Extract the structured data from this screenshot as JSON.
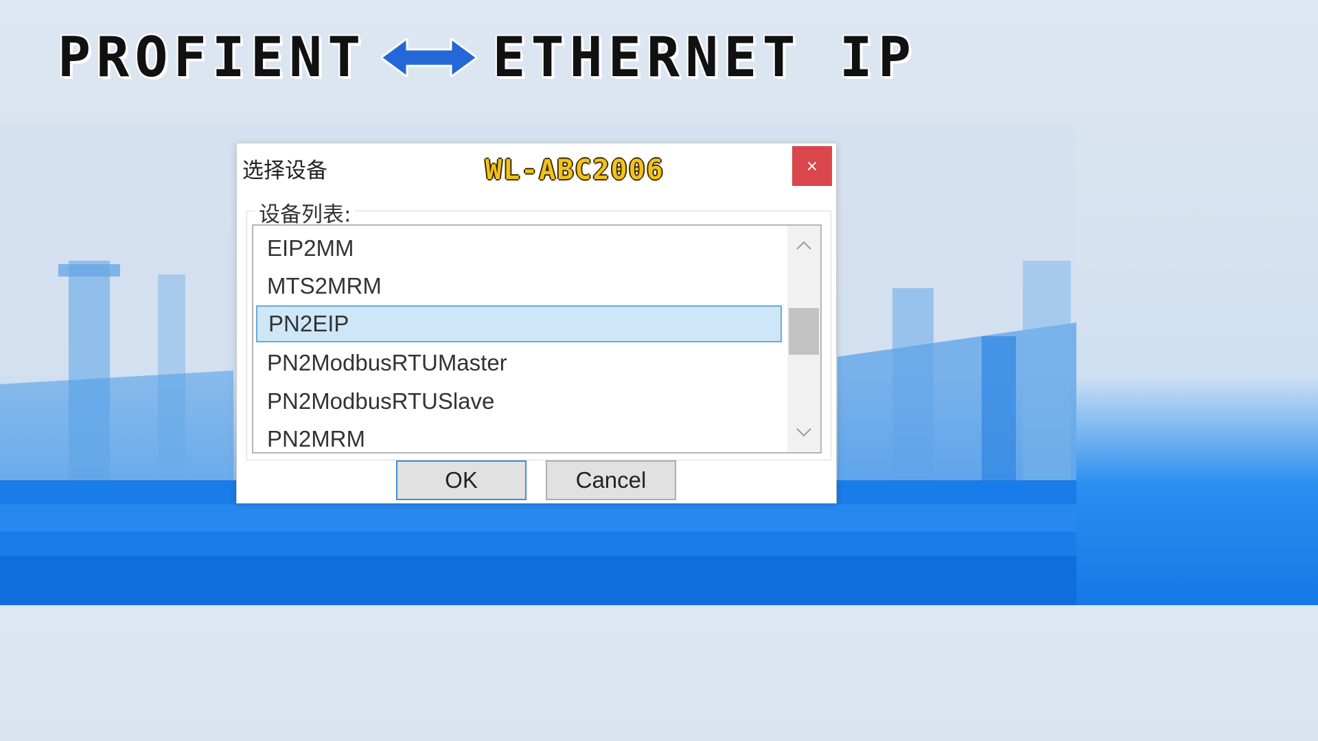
{
  "headline": {
    "left_word": "PROFIENT",
    "right_word": "ETHERNET IP",
    "arrow_icon": "double-arrow-icon",
    "arrow_color": "#2468d8"
  },
  "dialog": {
    "title": "选择设备",
    "model_label": "WL-ABC2006",
    "close_label": "×",
    "group_label": "设备列表:",
    "items": [
      {
        "label": "EIP2MM",
        "selected": false
      },
      {
        "label": "MTS2MRM",
        "selected": false
      },
      {
        "label": "PN2EIP",
        "selected": true
      },
      {
        "label": "PN2ModbusRTUMaster",
        "selected": false
      },
      {
        "label": "PN2ModbusRTUSlave",
        "selected": false
      },
      {
        "label": "PN2MRM",
        "selected": false
      }
    ],
    "scroll_up_icon": "chevron-up-icon",
    "scroll_down_icon": "chevron-down-icon",
    "ok_label": "OK",
    "cancel_label": "Cancel"
  },
  "colors": {
    "close_button": "#d9464b",
    "selection": "#cde7f8",
    "model_text": "#f2c21a",
    "background_blue": "#1478e6"
  }
}
